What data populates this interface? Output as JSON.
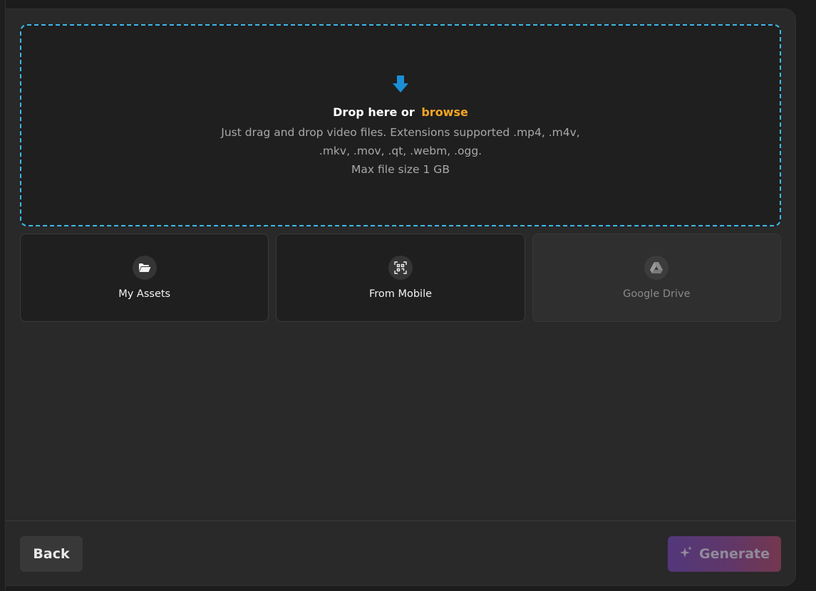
{
  "dropzone": {
    "title_prefix": "Drop here or",
    "browse_label": "browse",
    "desc_line1": "Just drag and drop video files. Extensions supported .mp4, .m4v,",
    "desc_line2": ".mkv, .mov, .qt, .webm, .ogg.",
    "desc_line3": "Max file size 1 GB",
    "icon": "download-arrow-icon",
    "accent_color": "#3fb8e8"
  },
  "sources": [
    {
      "label": "My Assets",
      "icon": "folder-open-icon",
      "enabled": true
    },
    {
      "label": "From Mobile",
      "icon": "qr-code-icon",
      "enabled": true
    },
    {
      "label": "Google Drive",
      "icon": "google-drive-icon",
      "enabled": false
    }
  ],
  "footer": {
    "back_label": "Back",
    "generate_label": "Generate",
    "generate_icon": "sparkle-icon"
  },
  "colors": {
    "browse": "#f5a623",
    "panel_bg": "#292929",
    "card_bg": "#1f1f1f"
  }
}
